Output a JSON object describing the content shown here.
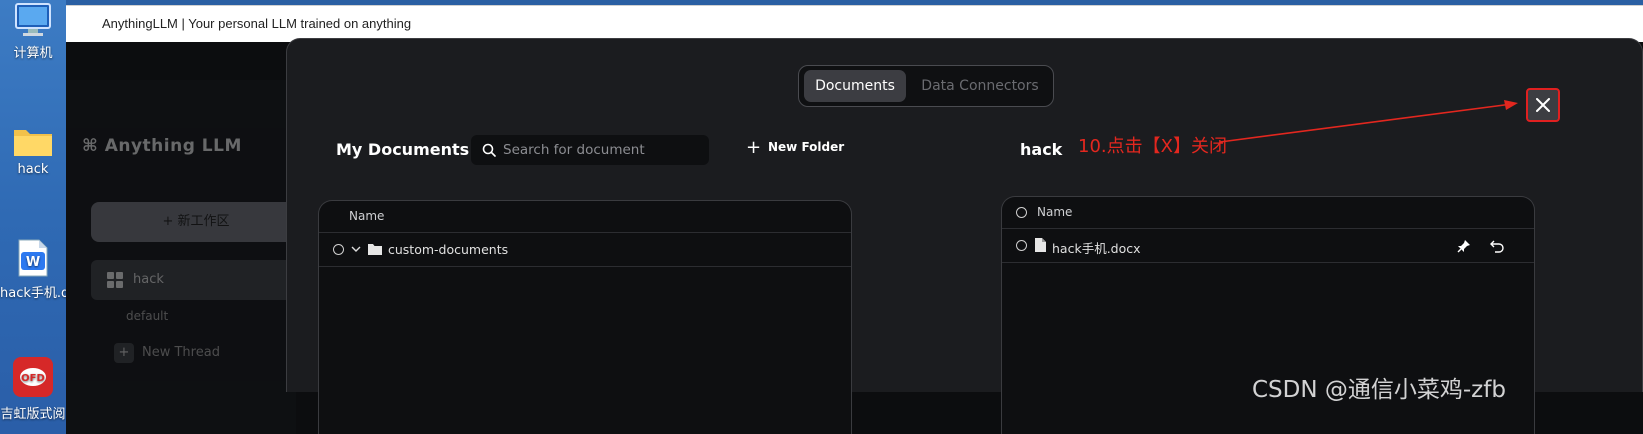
{
  "desktop": {
    "icons": [
      {
        "label": "计算机",
        "icon": "computer-icon"
      },
      {
        "label": "hack",
        "icon": "folder-icon"
      },
      {
        "label": "hack手机.doc",
        "icon": "wps-doc-icon"
      },
      {
        "label": "吉虹版式阅",
        "icon": "ofd-reader-icon"
      }
    ]
  },
  "window": {
    "title": "AnythingLLM | Your personal LLM trained on anything"
  },
  "sidebar": {
    "logo": "Anything LLM",
    "new_workspace": "+ 新工作区",
    "workspace": "hack",
    "thread": "default",
    "new_thread": "New Thread"
  },
  "modal": {
    "tabs": [
      {
        "label": "Documents",
        "active": true
      },
      {
        "label": "Data Connectors",
        "active": false
      }
    ],
    "close_icon": "close-icon",
    "left": {
      "title": "My Documents",
      "search_placeholder": "Search for document",
      "new_folder": "New Folder",
      "column_name": "Name",
      "rows": [
        {
          "name": "custom-documents",
          "icon": "folder-icon"
        }
      ]
    },
    "right": {
      "title": "hack",
      "column_name": "Name",
      "rows": [
        {
          "name": "hack手机.docx",
          "icon": "file-icon"
        }
      ]
    }
  },
  "annotation": {
    "text": "10.点击【X】关闭",
    "color": "#e3271f"
  },
  "watermark": "CSDN @通信小菜鸡-zfb"
}
